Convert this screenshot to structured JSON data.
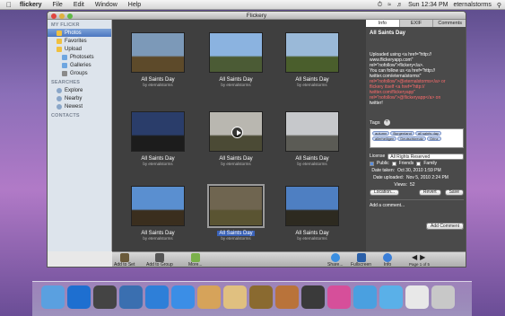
{
  "menubar": {
    "app_name": "flickery",
    "items": [
      "File",
      "Edit",
      "Window",
      "Help"
    ],
    "clock": "Sun 12:34 PM",
    "user": "eternalstorms"
  },
  "window": {
    "title": "Flickery"
  },
  "sidebar": {
    "section_myflickr": "MY FLICKR",
    "items": [
      {
        "label": "Photos",
        "selected": true,
        "color": "#f0c040"
      },
      {
        "label": "Favorites",
        "selected": false,
        "color": "#f0c040"
      },
      {
        "label": "Upload",
        "selected": false,
        "color": "#f0c040"
      },
      {
        "label": "Photosets",
        "selected": false,
        "color": "#6fa6e0"
      },
      {
        "label": "Galleries",
        "selected": false,
        "color": "#6fa6e0"
      },
      {
        "label": "Groups",
        "selected": false,
        "color": "#8a8a8a"
      }
    ],
    "section_searches": "SEARCHES",
    "search_items": [
      "Explore",
      "Nearby",
      "Newest"
    ],
    "section_contacts": "CONTACTS"
  },
  "photos": [
    {
      "title": "All Saints Day",
      "by": "by eternalstorms",
      "sky": "#7c99b8",
      "ground": "#5d4a2a",
      "video": false,
      "selected": false
    },
    {
      "title": "All Saints Day",
      "by": "by eternalstorms",
      "sky": "#8bb3e0",
      "ground": "#4b5b35",
      "video": false,
      "selected": false
    },
    {
      "title": "All Saints Day",
      "by": "by eternalstorms",
      "sky": "#9ab9d8",
      "ground": "#4a5e2c",
      "video": false,
      "selected": false
    },
    {
      "title": "All Saints Day",
      "by": "by eternalstorms",
      "sky": "#2a3d6a",
      "ground": "#1c1c1c",
      "video": false,
      "selected": false
    },
    {
      "title": "All Saints Day",
      "by": "by eternalstorms",
      "sky": "#b9b7b0",
      "ground": "#4b4a35",
      "video": true,
      "selected": false
    },
    {
      "title": "All Saints Day",
      "by": "by eternalstorms",
      "sky": "#c6c8cb",
      "ground": "#5b5b55",
      "video": false,
      "selected": false
    },
    {
      "title": "All Saints Day",
      "by": "by eternalstorms",
      "sky": "#5a8fd0",
      "ground": "#3a2e1e",
      "video": false,
      "selected": false
    },
    {
      "title": "All Saints Day",
      "by": "by eternalstorms",
      "sky": "#6f6550",
      "ground": "#5a5432",
      "video": false,
      "selected": true
    },
    {
      "title": "All Saints Day",
      "by": "by eternalstorms",
      "sky": "#4e7fc2",
      "ground": "#2d2a20",
      "video": false,
      "selected": false
    }
  ],
  "inspector": {
    "tabs": [
      "Info",
      "EXIF",
      "Comments"
    ],
    "title": "All Saints Day",
    "description_lines": [
      "Uploaded using <a href=\"http://",
      "www.flickeryapp.com\"",
      "rel=\"nofollow\">flickery</a>.",
      "You can follow us <a href=\"http://",
      "twitter.com/eternalstorms\"",
      "rel=\"nofollow\">@eternalstorms</a> or",
      "flickery itself <a href=\"http://",
      "twitter.com/flickeryapp\"",
      "rel=\"nofollow\">@flickeryapp</a> on",
      "twitter!"
    ],
    "tags_label": "Tags",
    "tags": [
      "autumn",
      "Burgenland",
      "all saints day",
      "allerheiligen",
      "Deutschkreutz",
      "Grinz"
    ],
    "license_label": "License",
    "license_value": "All Rights Reserved",
    "public_label": "Public",
    "friends_label": "Friends",
    "family_label": "Family",
    "date_taken_label": "Date taken:",
    "date_taken": "Oct 30, 2010 1:59 PM",
    "date_uploaded_label": "Date uploaded:",
    "date_uploaded": "Nov 5, 2010 2:24 PM",
    "views_label": "Views:",
    "views": "52",
    "location_btn": "Location...",
    "revert_btn": "Revert",
    "save_btn": "Save",
    "add_comment_placeholder": "Add a comment...",
    "add_comment_btn": "Add Comment"
  },
  "toolbar": {
    "add_to_set": "Add to Set",
    "add_to_group": "Add to Group",
    "more": "More...",
    "share": "Share...",
    "fullscreen": "Fullscreen",
    "info": "Info",
    "page": "Page 1 of 5"
  },
  "dock_colors": [
    "#5aa0e0",
    "#1e6fd0",
    "#444",
    "#3a6fb0",
    "#2e7fd8",
    "#3b8ee6",
    "#d6a35a",
    "#e0c080",
    "#8a6a30",
    "#b9733a",
    "#3a3a3a",
    "#d64f9a",
    "#4aa0e0",
    "#5ab0e8",
    "#e8e8e8",
    "#c8c8c8"
  ]
}
